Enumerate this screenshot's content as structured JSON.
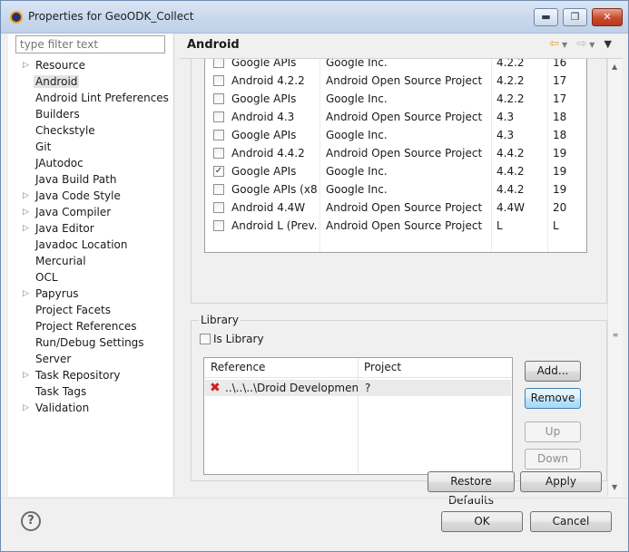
{
  "window": {
    "title": "Properties for GeoODK_Collect",
    "controls": {
      "minimize": "▬",
      "maximize": "❐",
      "close": "✕"
    }
  },
  "filter": {
    "placeholder": "type filter text"
  },
  "nav_items": [
    {
      "label": "Resource",
      "expandable": true
    },
    {
      "label": "Android",
      "selected": true
    },
    {
      "label": "Android Lint Preferences"
    },
    {
      "label": "Builders"
    },
    {
      "label": "Checkstyle"
    },
    {
      "label": "Git"
    },
    {
      "label": "JAutodoc"
    },
    {
      "label": "Java Build Path"
    },
    {
      "label": "Java Code Style",
      "expandable": true
    },
    {
      "label": "Java Compiler",
      "expandable": true
    },
    {
      "label": "Java Editor",
      "expandable": true
    },
    {
      "label": "Javadoc Location"
    },
    {
      "label": "Mercurial"
    },
    {
      "label": "OCL"
    },
    {
      "label": "Papyrus",
      "expandable": true
    },
    {
      "label": "Project Facets"
    },
    {
      "label": "Project References"
    },
    {
      "label": "Run/Debug Settings"
    },
    {
      "label": "Server"
    },
    {
      "label": "Task Repository",
      "expandable": true
    },
    {
      "label": "Task Tags"
    },
    {
      "label": "Validation",
      "expandable": true
    }
  ],
  "page": {
    "title": "Android",
    "icons": {
      "back": "back-arrow-icon",
      "forward": "forward-arrow-icon",
      "menu": "view-menu-icon"
    }
  },
  "targets": [
    {
      "name": "Google APIs",
      "vendor": "Google Inc.",
      "platform": "4.2.2",
      "api": "16",
      "checked": false
    },
    {
      "name": "Android 4.2.2",
      "vendor": "Android Open Source Project",
      "platform": "4.2.2",
      "api": "17",
      "checked": false
    },
    {
      "name": "Google APIs",
      "vendor": "Google Inc.",
      "platform": "4.2.2",
      "api": "17",
      "checked": false
    },
    {
      "name": "Android 4.3",
      "vendor": "Android Open Source Project",
      "platform": "4.3",
      "api": "18",
      "checked": false
    },
    {
      "name": "Google APIs",
      "vendor": "Google Inc.",
      "platform": "4.3",
      "api": "18",
      "checked": false
    },
    {
      "name": "Android 4.4.2",
      "vendor": "Android Open Source Project",
      "platform": "4.4.2",
      "api": "19",
      "checked": false
    },
    {
      "name": "Google APIs",
      "vendor": "Google Inc.",
      "platform": "4.4.2",
      "api": "19",
      "checked": true
    },
    {
      "name": "Google APIs (x8...",
      "vendor": "Google Inc.",
      "platform": "4.4.2",
      "api": "19",
      "checked": false
    },
    {
      "name": "Android 4.4W",
      "vendor": "Android Open Source Project",
      "platform": "4.4W",
      "api": "20",
      "checked": false
    },
    {
      "name": "Android L (Prev...",
      "vendor": "Android Open Source Project",
      "platform": "L",
      "api": "L",
      "checked": false
    }
  ],
  "library": {
    "group_label": "Library",
    "is_library_label": "Is Library",
    "is_library_checked": false,
    "columns": {
      "reference": "Reference",
      "project": "Project"
    },
    "rows": [
      {
        "reference": "..\\..\\..\\Droid Developmen...",
        "project": "?",
        "status_icon": "error-icon"
      }
    ],
    "buttons": {
      "add": "Add...",
      "remove": "Remove",
      "up": "Up",
      "down": "Down"
    }
  },
  "actions": {
    "restore_defaults": "Restore Defaults",
    "apply": "Apply",
    "ok": "OK",
    "cancel": "Cancel",
    "help": "?"
  }
}
